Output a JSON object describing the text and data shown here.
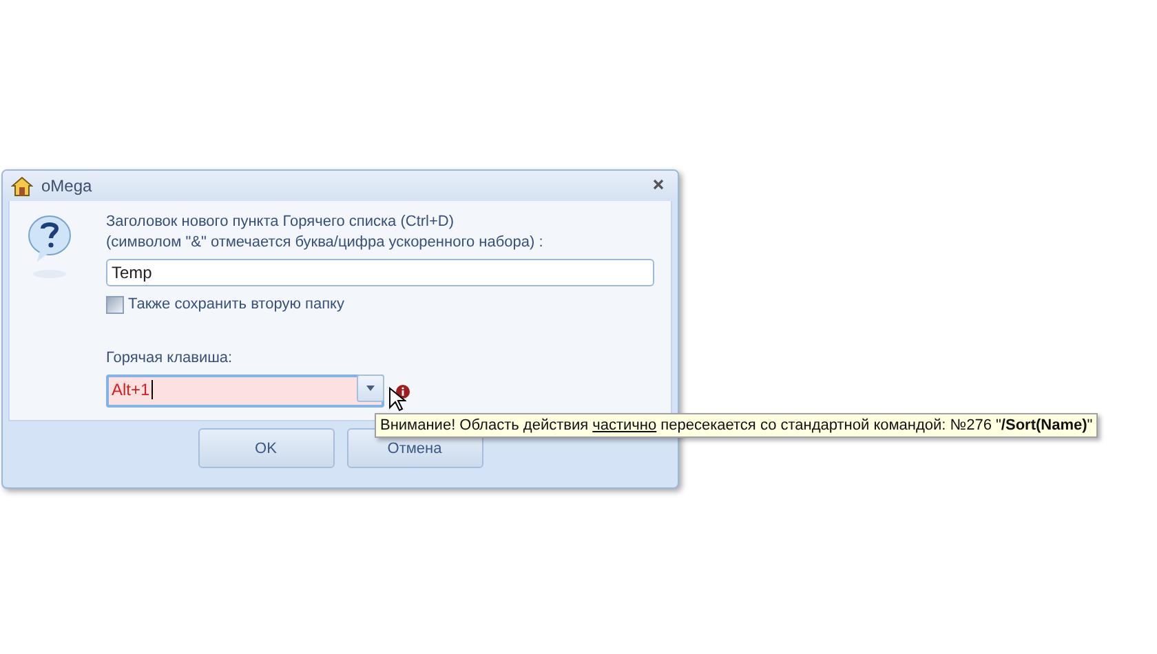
{
  "window": {
    "title": "oMega"
  },
  "prompt": {
    "lines": [
      "Заголовок нового пункта Горячего списка (Ctrl+D)",
      "(символом \"&\" отмечается буква/цифра ускоренного набора) :"
    ]
  },
  "name_field": {
    "value": "Temp"
  },
  "save_second_folder": {
    "label": "Также сохранить вторую папку",
    "checked": false
  },
  "hotkey": {
    "label": "Горячая клавиша:",
    "value": "Alt+1",
    "invalid": true
  },
  "buttons": [
    "OK",
    "Отмена"
  ],
  "tooltip": {
    "segments": [
      {
        "text": "Внимание! Область действия ",
        "kind": "plain"
      },
      {
        "text": "частично",
        "kind": "underline"
      },
      {
        "text": " пересекается со стандартной командой: №276 \"",
        "kind": "plain"
      },
      {
        "text": "/Sort(Name)",
        "kind": "bold"
      },
      {
        "text": "\"",
        "kind": "plain"
      }
    ]
  }
}
